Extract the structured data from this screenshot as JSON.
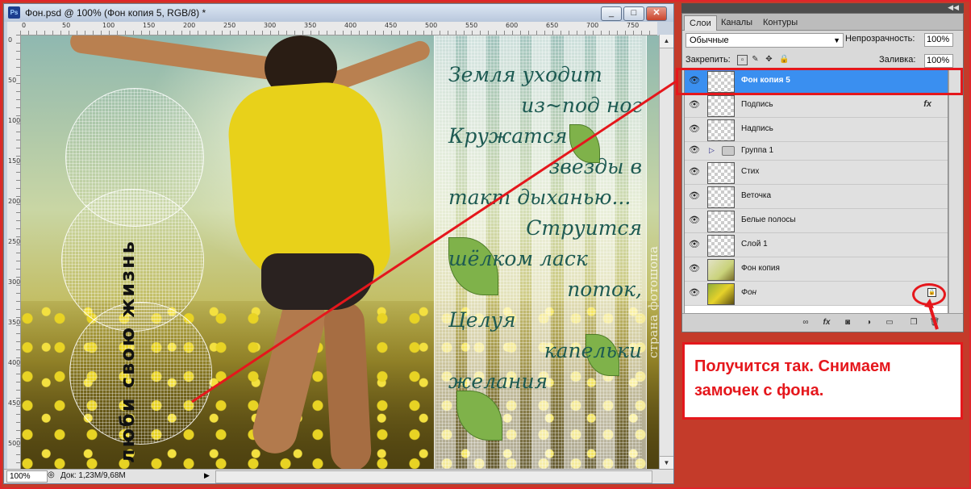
{
  "document": {
    "title": "Фон.psd @ 100% (Фон копия 5, RGB/8) *",
    "app_icon": "Ps",
    "minimize": "_",
    "maximize": "□",
    "close": "✕",
    "ruler_h": [
      "0",
      "50",
      "100",
      "150",
      "200",
      "250",
      "300",
      "350",
      "400",
      "450",
      "500",
      "550",
      "600",
      "650",
      "700",
      "750"
    ],
    "ruler_v": [
      "0",
      "50",
      "100",
      "150",
      "200",
      "250",
      "300",
      "350",
      "400",
      "450",
      "500"
    ],
    "zoom": "100%",
    "doc_info": "Док: 1,23M/9,68M",
    "artwork": {
      "poem_lines": [
        "Земля уходит",
        "из~под ног",
        "Кружатся",
        "звезды в",
        "такт дыханью...",
        "Струится",
        "шёлком ласк",
        "поток,",
        "Целуя",
        "капельки",
        "желания"
      ],
      "vertical_text": "люби свою жизнь",
      "stamp": "страна фотошопа"
    }
  },
  "layers_panel": {
    "collapse_icon": "◀◀",
    "tabs": [
      {
        "label": "Слои",
        "active": true
      },
      {
        "label": "Каналы",
        "active": false
      },
      {
        "label": "Контуры",
        "active": false
      }
    ],
    "blend_mode": "Обычные",
    "opacity_label": "Непрозрачность:",
    "opacity_value": "100%",
    "lock_label": "Закрепить:",
    "fill_label": "Заливка:",
    "fill_value": "100%",
    "fx_label": "fx",
    "layers": [
      {
        "name": "Фон копия 5",
        "selected": true
      },
      {
        "name": "Подпись",
        "fx": true
      },
      {
        "name": "Надпись"
      },
      {
        "name": "Группа 1",
        "group": true
      },
      {
        "name": "Стих"
      },
      {
        "name": "Веточка"
      },
      {
        "name": "Белые полосы"
      },
      {
        "name": "Слой 1"
      },
      {
        "name": "Фон копия"
      },
      {
        "name": "Фон",
        "locked": true
      }
    ]
  },
  "annotation": {
    "text": "Получится так. Снимаем замочек с фона.",
    "color": "#e5171c"
  },
  "colors": {
    "selection": "#3a8ff0",
    "accent_red": "#e5171c"
  }
}
